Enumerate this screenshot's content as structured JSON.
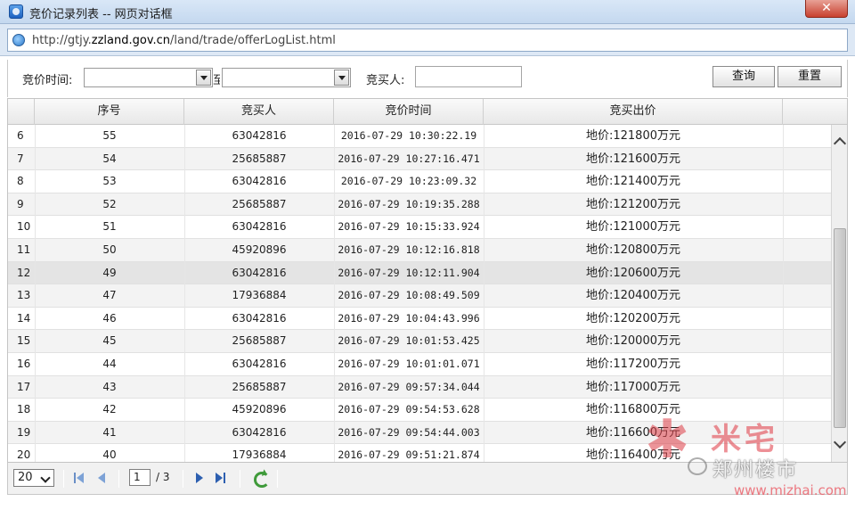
{
  "window": {
    "title": "竞价记录列表 -- 网页对话框",
    "close_label": "✕"
  },
  "address": {
    "url_prefix": "http://gtjy.",
    "url_domain": "zzland.gov.cn",
    "url_path": "/land/trade/offerLogList.html"
  },
  "filter": {
    "time_label": "竞价时间:",
    "time_separator": "至",
    "buyer_label": "竞买人:",
    "time_from_value": "",
    "time_to_value": "",
    "buyer_value": "",
    "query_button": "查询",
    "reset_button": "重置"
  },
  "table": {
    "headers": [
      "序号",
      "竞买人",
      "竞价时间",
      "竞买出价"
    ],
    "rows": [
      {
        "idx": "6",
        "seq": "55",
        "buyer": "63042816",
        "time": "2016-07-29 10:30:22.19",
        "price": "地价:121800万元"
      },
      {
        "idx": "7",
        "seq": "54",
        "buyer": "25685887",
        "time": "2016-07-29 10:27:16.471",
        "price": "地价:121600万元"
      },
      {
        "idx": "8",
        "seq": "53",
        "buyer": "63042816",
        "time": "2016-07-29 10:23:09.32",
        "price": "地价:121400万元"
      },
      {
        "idx": "9",
        "seq": "52",
        "buyer": "25685887",
        "time": "2016-07-29 10:19:35.288",
        "price": "地价:121200万元"
      },
      {
        "idx": "10",
        "seq": "51",
        "buyer": "63042816",
        "time": "2016-07-29 10:15:33.924",
        "price": "地价:121000万元"
      },
      {
        "idx": "11",
        "seq": "50",
        "buyer": "45920896",
        "time": "2016-07-29 10:12:16.818",
        "price": "地价:120800万元"
      },
      {
        "idx": "12",
        "seq": "49",
        "buyer": "63042816",
        "time": "2016-07-29 10:12:11.904",
        "price": "地价:120600万元"
      },
      {
        "idx": "13",
        "seq": "47",
        "buyer": "17936884",
        "time": "2016-07-29 10:08:49.509",
        "price": "地价:120400万元"
      },
      {
        "idx": "14",
        "seq": "46",
        "buyer": "63042816",
        "time": "2016-07-29 10:04:43.996",
        "price": "地价:120200万元"
      },
      {
        "idx": "15",
        "seq": "45",
        "buyer": "25685887",
        "time": "2016-07-29 10:01:53.425",
        "price": "地价:120000万元"
      },
      {
        "idx": "16",
        "seq": "44",
        "buyer": "63042816",
        "time": "2016-07-29 10:01:01.071",
        "price": "地价:117200万元"
      },
      {
        "idx": "17",
        "seq": "43",
        "buyer": "25685887",
        "time": "2016-07-29 09:57:34.044",
        "price": "地价:117000万元"
      },
      {
        "idx": "18",
        "seq": "42",
        "buyer": "45920896",
        "time": "2016-07-29 09:54:53.628",
        "price": "地价:116800万元"
      },
      {
        "idx": "19",
        "seq": "41",
        "buyer": "63042816",
        "time": "2016-07-29 09:54:44.003",
        "price": "地价:116600万元"
      },
      {
        "idx": "20",
        "seq": "40",
        "buyer": "17936884",
        "time": "2016-07-29 09:51:21.874",
        "price": "地价:116400万元"
      }
    ]
  },
  "pager": {
    "page_size": "20",
    "current_page": "1",
    "total_pages": "/ 3"
  },
  "watermark": {
    "brand": "米宅",
    "city": "郑州楼市",
    "site": "www.mizhai.com"
  },
  "colors": {
    "accent": "#2d5fb0",
    "refresh": "#3f9a3a",
    "watermark": "#e14650"
  }
}
